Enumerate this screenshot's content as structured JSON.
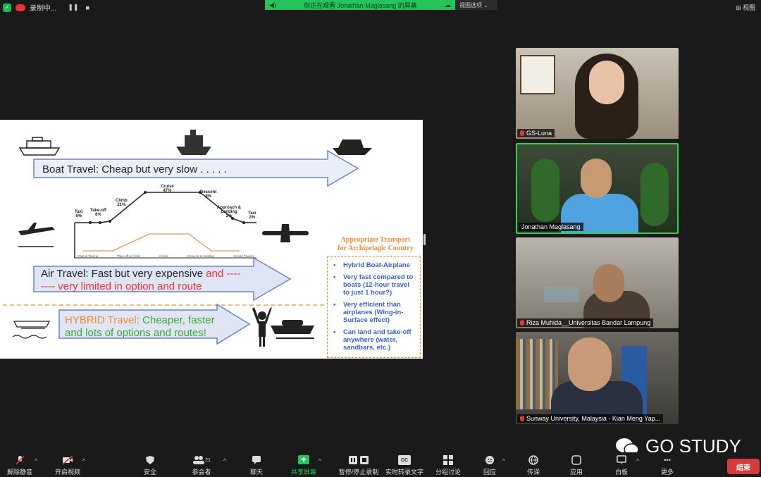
{
  "topbar": {
    "recording_label": "录制中...",
    "pause_glyph": "❚❚",
    "stop_glyph": "■",
    "viewing_text": "你正在观看 Jonathan Maglasang 的屏幕",
    "view_options": "视图选项 ⌄",
    "view_button": "视图"
  },
  "slide": {
    "boat_label": "Boat Travel: Cheap but very slow . . . . .",
    "air_label_a": "Air Travel: Fast but very expensive",
    "air_label_b": "and ----",
    "air_label_c": "---- very limited in option and route",
    "hybrid_a": "HYBRID Travel",
    "hybrid_b": ": Cheaper, faster",
    "hybrid_c": "and lots of options and routes!",
    "profile": {
      "cruise": "Cruise",
      "cruise_pct": "47%",
      "climb": "Climb",
      "climb_pct": "21%",
      "descent": "Descent",
      "descent_pct": "8%",
      "takeoff": "Take-off",
      "takeoff_pct": "6%",
      "taxi1": "Taxi",
      "taxi1_pct": "6%",
      "approach": "Approach &",
      "landing": "Landing",
      "approach_pct": "2%",
      "taxi2": "Taxi",
      "taxi2_pct": "2%",
      "phases": [
        "Gate & Taxiing",
        "Take-off & Climb",
        "Cruise",
        "Descent & Landing",
        "Arrival/ Taxiing"
      ]
    },
    "info_title_1": "Appropriate Transport",
    "info_title_2": "for Archipelagic Country",
    "info_items": [
      "Hybrid Boat-Airplane",
      "Very fast compared to boats (12-hour travel to just 1 hour?)",
      "Very efficient than airplanes (Wing-in-Surface effect)",
      "Can land and take-off anywhere (water, sandbars, etc.)"
    ]
  },
  "participants": [
    {
      "name": "GS-Luna",
      "muted": true
    },
    {
      "name": "Jonathan Maglasang",
      "muted": false
    },
    {
      "name": "Riza Muhida__Universitas Bandar Lampung",
      "muted": true
    },
    {
      "name": "Sunway University, Malaysia - Kian Meng Yap...",
      "muted": true
    }
  ],
  "toolbar": {
    "unmute": "解除静音",
    "video": "开启视频",
    "security": "安全",
    "participants": "参会者",
    "participants_count": "21",
    "chat": "聊天",
    "share": "共享屏幕",
    "record": "暂停/停止录制",
    "captions": "实时转录文字",
    "captions_badge": "CC",
    "breakout": "分组讨论",
    "reactions": "回应",
    "interpret": "传译",
    "apps": "应用",
    "whiteboard": "白板",
    "more": "更多",
    "end": "结束"
  },
  "watermark": "GO STUDY",
  "colors": {
    "share_green": "#24c35c",
    "end_red": "#d63c3c",
    "active_border": "#2fd34f"
  }
}
